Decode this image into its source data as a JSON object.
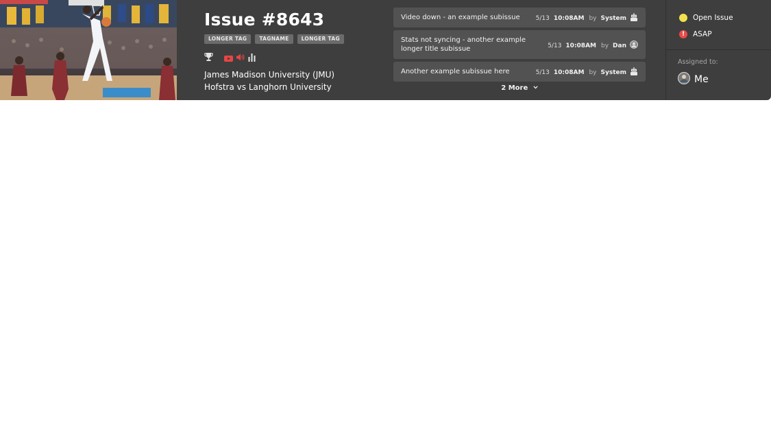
{
  "issue": {
    "title": "Issue #8643",
    "tags": [
      "LONGER TAG",
      "TAGNAME",
      "LONGER TAG"
    ],
    "icons": [
      "trophy-icon",
      "youtube-icon",
      "speaker-icon",
      "bar-chart-icon"
    ],
    "team1": "James Madison University (JMU)",
    "team2": "Hofstra vs Langhorn University"
  },
  "subissues": [
    {
      "title": "Video down - an example subissue",
      "date": "5/13",
      "time": "10:08AM",
      "by": "by",
      "user": "System",
      "user_icon": "robot-icon"
    },
    {
      "title": "Stats not syncing - another example longer title subissue",
      "date": "5/13",
      "time": "10:08AM",
      "by": "by",
      "user": "Dan",
      "user_icon": "avatar-icon"
    },
    {
      "title": "Another example subissue here",
      "date": "5/13",
      "time": "10:08AM",
      "by": "by",
      "user": "System",
      "user_icon": "robot-icon"
    }
  ],
  "more_label": "2 More",
  "status": {
    "state": "Open Issue",
    "priority": "ASAP",
    "assigned_label": "Assigned to:",
    "assignee": "Me"
  },
  "colors": {
    "card_bg": "#3e3e3e",
    "subissue_bg": "#525252",
    "open_yellow": "#f2e14d",
    "asap_red": "#ea4a4a",
    "media_red": "#e84545"
  }
}
